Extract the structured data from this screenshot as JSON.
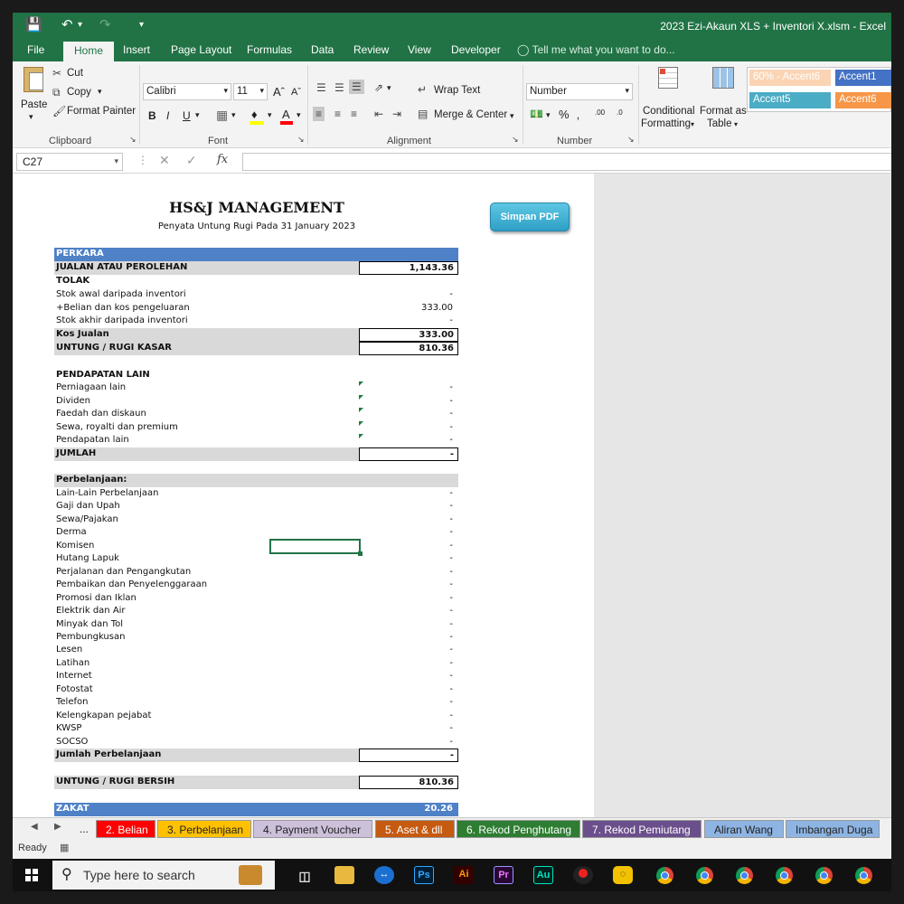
{
  "window": {
    "title": "2023 Ezi-Akaun XLS + Inventori X.xlsm - Excel"
  },
  "menu_tabs": [
    "File",
    "Home",
    "Insert",
    "Page Layout",
    "Formulas",
    "Data",
    "Review",
    "View",
    "Developer"
  ],
  "tell_me": "Tell me what you want to do...",
  "ribbon": {
    "clipboard": {
      "paste": "Paste",
      "cut": "Cut",
      "copy": "Copy",
      "format_painter": "Format Painter",
      "label": "Clipboard"
    },
    "font": {
      "name": "Calibri",
      "size": "11",
      "label": "Font"
    },
    "alignment": {
      "wrap_text": "Wrap Text",
      "merge_center": "Merge & Center",
      "label": "Alignment"
    },
    "number": {
      "format": "Number",
      "label": "Number"
    },
    "styles": {
      "conditional": "Conditional",
      "formatting": "Formatting",
      "format_as": "Format as",
      "table": "Table",
      "cells": [
        {
          "label": "60% - Accent6",
          "bg": "#fbd4b4",
          "fg": "#ffffff"
        },
        {
          "label": "Accent1",
          "bg": "#4472c4",
          "fg": "#ffffff"
        },
        {
          "label": "Accent5",
          "bg": "#4bacc6",
          "fg": "#ffffff"
        },
        {
          "label": "Accent6",
          "bg": "#f79646",
          "fg": "#ffffff"
        }
      ]
    }
  },
  "name_box": "C27",
  "sheet": {
    "company": "HS&J MANAGEMENT",
    "subtitle": "Penyata Untung Rugi Pada 31 January 2023",
    "pdf_button": "Simpan PDF",
    "header": "PERKARA",
    "sales_label": "JUALAN ATAU PEROLEHAN",
    "sales_value": "1,143.36",
    "less": "TOLAK",
    "cogs_items": [
      {
        "label": "Stok awal daripada inventori",
        "value": "-"
      },
      {
        "label": "+Belian dan kos pengeluaran",
        "value": "333.00"
      },
      {
        "label": "Stok akhir daripada inventori",
        "value": "-"
      }
    ],
    "cost_label": "Kos Jualan",
    "cost_value": "333.00",
    "gross_label": "UNTUNG / RUGI KASAR",
    "gross_value": "810.36",
    "other_income_title": "PENDAPATAN LAIN",
    "other_income": [
      {
        "label": "Perniagaan lain",
        "value": "-"
      },
      {
        "label": "Dividen",
        "value": "-"
      },
      {
        "label": "Faedah dan diskaun",
        "value": "-"
      },
      {
        "label": "Sewa, royalti dan premium",
        "value": "-"
      },
      {
        "label": "Pendapatan lain",
        "value": "-"
      }
    ],
    "total_label": "JUMLAH",
    "total_value": "-",
    "expenses_title": "Perbelanjaan:",
    "expenses": [
      {
        "label": "Lain-Lain Perbelanjaan",
        "value": "-"
      },
      {
        "label": "Gaji dan Upah",
        "value": "-"
      },
      {
        "label": "Sewa/Pajakan",
        "value": "-"
      },
      {
        "label": "Derma",
        "value": "-"
      },
      {
        "label": "Komisen",
        "value": "-"
      },
      {
        "label": "Hutang Lapuk",
        "value": "-"
      },
      {
        "label": "Perjalanan dan Pengangkutan",
        "value": "-"
      },
      {
        "label": "Pembaikan dan Penyelenggaraan",
        "value": "-"
      },
      {
        "label": "Promosi dan Iklan",
        "value": "-"
      },
      {
        "label": "Elektrik dan Air",
        "value": "-"
      },
      {
        "label": "Minyak dan Tol",
        "value": "-"
      },
      {
        "label": "Pembungkusan",
        "value": "-"
      },
      {
        "label": "Lesen",
        "value": "-"
      },
      {
        "label": "Latihan",
        "value": "-"
      },
      {
        "label": "Internet",
        "value": "-"
      },
      {
        "label": "Fotostat",
        "value": "-"
      },
      {
        "label": "Telefon",
        "value": "-"
      },
      {
        "label": "Kelengkapan pejabat",
        "value": "-"
      },
      {
        "label": "KWSP",
        "value": "-"
      },
      {
        "label": "SOCSO",
        "value": "-"
      }
    ],
    "total_expenses_label": "Jumlah Perbelanjaan",
    "total_expenses_value": "-",
    "net_label": "UNTUNG / RUGI BERSIH",
    "net_value": "810.36",
    "zakat_label": "ZAKAT",
    "zakat_value": "20.26"
  },
  "sheet_tabs": [
    {
      "label": "...",
      "bg": "#f0f0f0",
      "fg": "#222222"
    },
    {
      "label": "2. Belian",
      "bg": "#ff0000",
      "fg": "#ffffff"
    },
    {
      "label": "3. Perbelanjaan",
      "bg": "#ffc000",
      "fg": "#222222"
    },
    {
      "label": "4. Payment Voucher",
      "bg": "#ccc0da",
      "fg": "#222222"
    },
    {
      "label": "5. Aset & dll",
      "bg": "#c55a11",
      "fg": "#ffffff"
    },
    {
      "label": "6. Rekod Penghutang",
      "bg": "#2e7d32",
      "fg": "#ffffff"
    },
    {
      "label": "7. Rekod Pemiutang",
      "bg": "#6b4f8c",
      "fg": "#ffffff"
    },
    {
      "label": "Aliran Wang",
      "bg": "#8db4e2",
      "fg": "#222222"
    },
    {
      "label": "Imbangan Duga",
      "bg": "#8db4e2",
      "fg": "#222222"
    }
  ],
  "status": "Ready",
  "taskbar": {
    "search_placeholder": "Type here to search"
  }
}
